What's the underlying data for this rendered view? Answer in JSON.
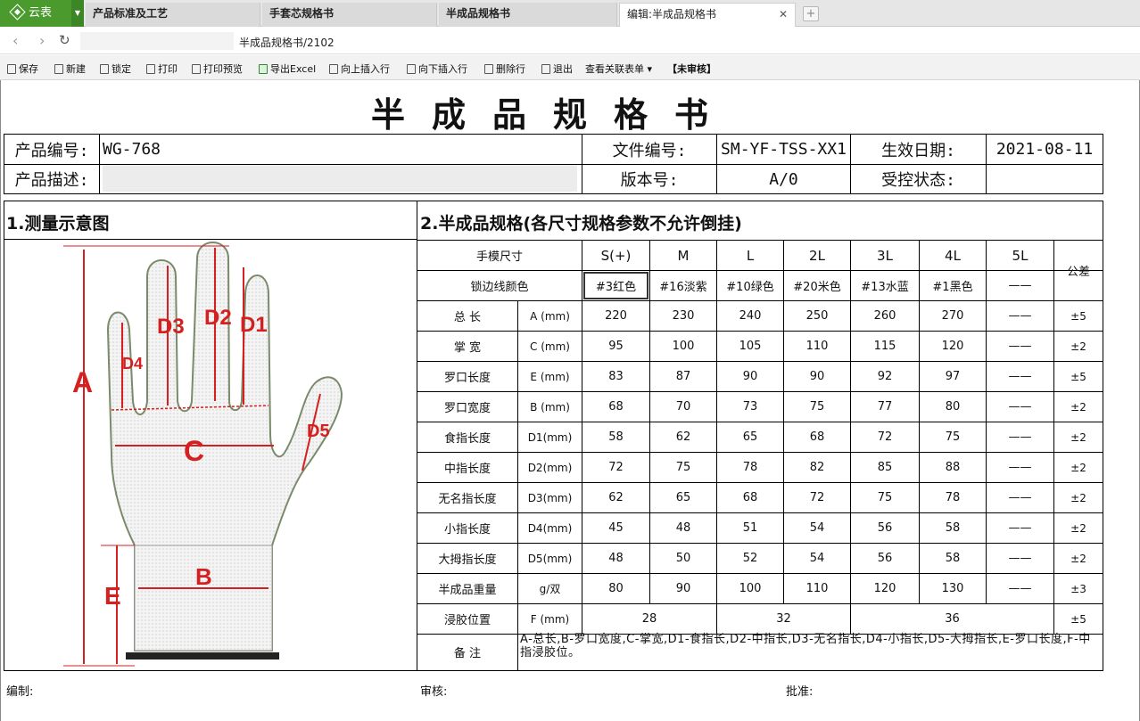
{
  "app": {
    "name": "云表"
  },
  "tabs": [
    {
      "label": "产品标准及工艺",
      "active": false
    },
    {
      "label": "手套芯规格书",
      "active": false
    },
    {
      "label": "半成品规格书",
      "active": false
    },
    {
      "label": "编辑:半成品规格书",
      "active": true
    }
  ],
  "address": {
    "path": "半成品规格书/2102"
  },
  "toolbar": [
    {
      "label": "保存",
      "icon": "save-icon"
    },
    {
      "label": "新建",
      "icon": "new-icon"
    },
    {
      "label": "锁定",
      "icon": "lock-icon"
    },
    {
      "label": "打印",
      "icon": "print-icon"
    },
    {
      "label": "打印预览",
      "icon": "print-preview-icon"
    },
    {
      "label": "导出Excel",
      "icon": "excel-icon"
    },
    {
      "label": "向上插入行",
      "icon": "insert-up-icon"
    },
    {
      "label": "向下插入行",
      "icon": "insert-down-icon"
    },
    {
      "label": "删除行",
      "icon": "delete-row-icon"
    },
    {
      "label": "退出",
      "icon": "exit-icon"
    },
    {
      "label": "查看关联表单",
      "icon": "dropdown-icon"
    },
    {
      "label": "【未审核】",
      "icon": ""
    }
  ],
  "doc": {
    "title": "半成品规格书",
    "product_code_label": "产品编号:",
    "product_code": "WG-768",
    "file_no_label": "文件编号:",
    "file_no": "SM-YF-TSS-XX1",
    "effective_date_label": "生效日期:",
    "effective_date": "2021-08-11",
    "product_desc_label": "产品描述:",
    "version_label": "版本号:",
    "version": "A/0",
    "control_label": "受控状态:",
    "section1": "1.测量示意图",
    "section2": "2.半成品规格(各尺寸规格参数不允许倒挂)",
    "size_header": "手模尺寸",
    "color_header": "锁边线颜色",
    "tolerance_header": "公差",
    "sizes": [
      "S(+)",
      "M",
      "L",
      "2L",
      "3L",
      "4L",
      "5L"
    ],
    "colors": [
      "#3红色",
      "#16淡紫",
      "#10绿色",
      "#20米色",
      "#13水蓝",
      "#1黑色",
      "——"
    ],
    "rows": [
      {
        "name": "总 长",
        "code": "A (mm)",
        "values": [
          "220",
          "230",
          "240",
          "250",
          "260",
          "270",
          "——"
        ],
        "tol": "±5"
      },
      {
        "name": "掌 宽",
        "code": "C (mm)",
        "values": [
          "95",
          "100",
          "105",
          "110",
          "115",
          "120",
          "——"
        ],
        "tol": "±2"
      },
      {
        "name": "罗口长度",
        "code": "E (mm)",
        "values": [
          "83",
          "87",
          "90",
          "90",
          "92",
          "97",
          "——"
        ],
        "tol": "±5"
      },
      {
        "name": "罗口宽度",
        "code": "B (mm)",
        "values": [
          "68",
          "70",
          "73",
          "75",
          "77",
          "80",
          "——"
        ],
        "tol": "±2"
      },
      {
        "name": "食指长度",
        "code": "D1(mm)",
        "values": [
          "58",
          "62",
          "65",
          "68",
          "72",
          "75",
          "——"
        ],
        "tol": "±2"
      },
      {
        "name": "中指长度",
        "code": "D2(mm)",
        "values": [
          "72",
          "75",
          "78",
          "82",
          "85",
          "88",
          "——"
        ],
        "tol": "±2"
      },
      {
        "name": "无名指长度",
        "code": "D3(mm)",
        "values": [
          "62",
          "65",
          "68",
          "72",
          "75",
          "78",
          "——"
        ],
        "tol": "±2"
      },
      {
        "name": "小指长度",
        "code": "D4(mm)",
        "values": [
          "45",
          "48",
          "51",
          "54",
          "56",
          "58",
          "——"
        ],
        "tol": "±2"
      },
      {
        "name": "大拇指长度",
        "code": "D5(mm)",
        "values": [
          "48",
          "50",
          "52",
          "54",
          "56",
          "58",
          "——"
        ],
        "tol": "±2"
      },
      {
        "name": "半成品重量",
        "code": "g/双",
        "values": [
          "80",
          "90",
          "100",
          "110",
          "120",
          "130",
          "——"
        ],
        "tol": "±3"
      }
    ],
    "dip_row": {
      "name": "浸胶位置",
      "code": "F (mm)",
      "values": [
        "28",
        "32",
        "36"
      ],
      "tol": "±5"
    },
    "remark_label": "备 注",
    "remark": "A-总长,B-罗口宽度,C-掌宽,D1-食指长,D2-中指长,D3-无名指长,D4-小指长,D5-大拇指长,E-罗口长度,F-中指浸胶位。",
    "footer": {
      "prepared": "编制:",
      "reviewed": "审核:",
      "approved": "批准:"
    },
    "diagram_labels": [
      "A",
      "B",
      "C",
      "D1",
      "D2",
      "D3",
      "D4",
      "D5",
      "E"
    ],
    "accent_red": "#d42020"
  }
}
